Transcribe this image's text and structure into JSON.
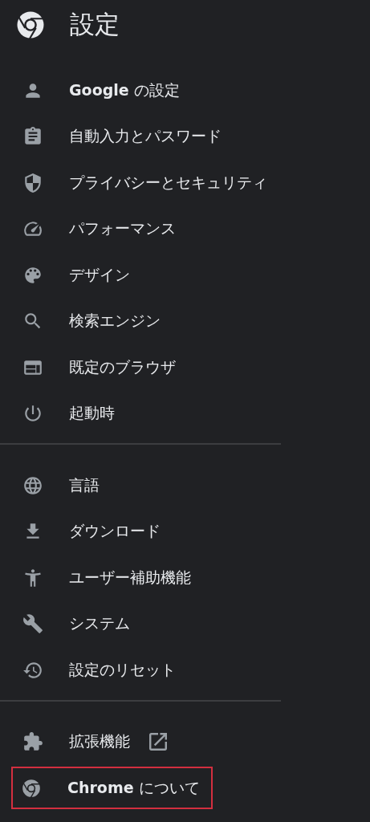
{
  "header": {
    "title": "設定"
  },
  "sections": [
    {
      "items": [
        {
          "label": "**Google** の設定",
          "external": false,
          "highlighted": false
        },
        {
          "label": "自動入力とパスワード",
          "external": false,
          "highlighted": false
        },
        {
          "label": "プライバシーとセキュリティ",
          "external": false,
          "highlighted": false
        },
        {
          "label": "パフォーマンス",
          "external": false,
          "highlighted": false
        },
        {
          "label": "デザイン",
          "external": false,
          "highlighted": false
        },
        {
          "label": "検索エンジン",
          "external": false,
          "highlighted": false
        },
        {
          "label": "既定のブラウザ",
          "external": false,
          "highlighted": false
        },
        {
          "label": "起動時",
          "external": false,
          "highlighted": false
        }
      ]
    },
    {
      "items": [
        {
          "label": "言語",
          "external": false,
          "highlighted": false
        },
        {
          "label": "ダウンロード",
          "external": false,
          "highlighted": false
        },
        {
          "label": "ユーザー補助機能",
          "external": false,
          "highlighted": false
        },
        {
          "label": "システム",
          "external": false,
          "highlighted": false
        },
        {
          "label": "設定のリセット",
          "external": false,
          "highlighted": false
        }
      ]
    },
    {
      "items": [
        {
          "label": "拡張機能",
          "external": true,
          "highlighted": false
        },
        {
          "label": "**Chrome** について",
          "external": false,
          "highlighted": true
        }
      ]
    }
  ]
}
